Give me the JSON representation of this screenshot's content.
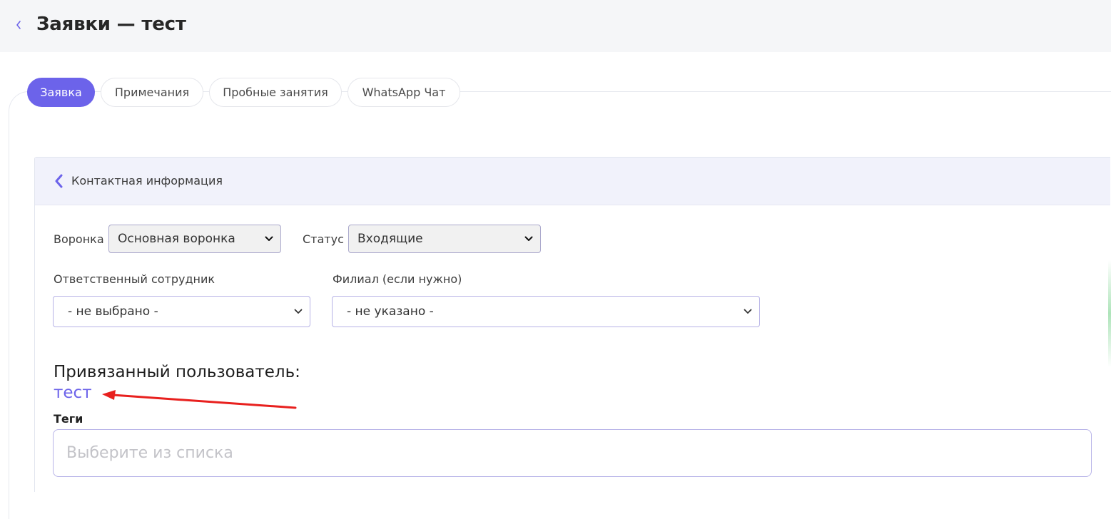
{
  "header": {
    "title": "Заявки — тест"
  },
  "tabs": [
    {
      "label": "Заявка",
      "active": true
    },
    {
      "label": "Примечания",
      "active": false
    },
    {
      "label": "Пробные занятия",
      "active": false
    },
    {
      "label": "WhatsApp Чат",
      "active": false
    }
  ],
  "panel": {
    "title": "Контактная информация"
  },
  "form": {
    "funnel": {
      "label": "Воронка",
      "value": "Основная воронка"
    },
    "status": {
      "label": "Статус",
      "value": "Входящие"
    },
    "responsible": {
      "label": "Ответственный сотрудник",
      "value": "- не выбрано -"
    },
    "branch": {
      "label": "Филиал (если нужно)",
      "value": "- не указано -"
    }
  },
  "linked_user": {
    "title": "Привязанный пользователь:",
    "name": "тест"
  },
  "tags": {
    "label": "Теги",
    "placeholder": "Выберите из списка"
  },
  "colors": {
    "accent": "#6c63ea",
    "header_bg": "#f5f6f8",
    "panel_header_bg": "#f1f2fb",
    "annotation": "#e8201e"
  }
}
